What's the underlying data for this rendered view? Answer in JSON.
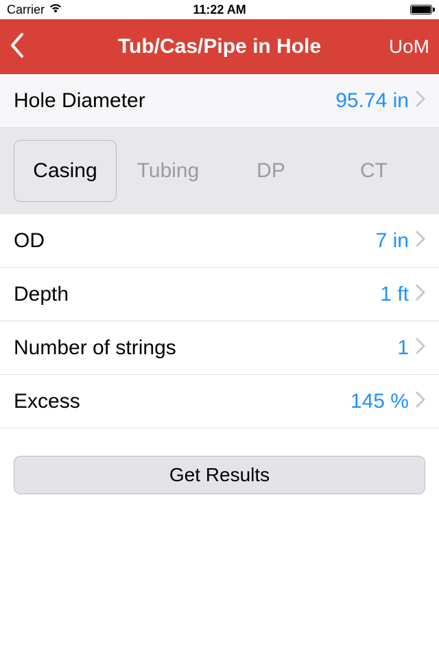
{
  "status": {
    "carrier": "Carrier",
    "time": "11:22 AM"
  },
  "nav": {
    "title": "Tub/Cas/Pipe in Hole",
    "right": "UoM"
  },
  "hole": {
    "label": "Hole Diameter",
    "value": "95.74 in"
  },
  "tabs": {
    "casing": "Casing",
    "tubing": "Tubing",
    "dp": "DP",
    "ct": "CT"
  },
  "rows": {
    "od": {
      "label": "OD",
      "value": "7 in"
    },
    "depth": {
      "label": "Depth",
      "value": "1 ft"
    },
    "strings": {
      "label": "Number of strings",
      "value": "1"
    },
    "excess": {
      "label": "Excess",
      "value": "145 %"
    }
  },
  "button": {
    "get_results": "Get Results"
  }
}
